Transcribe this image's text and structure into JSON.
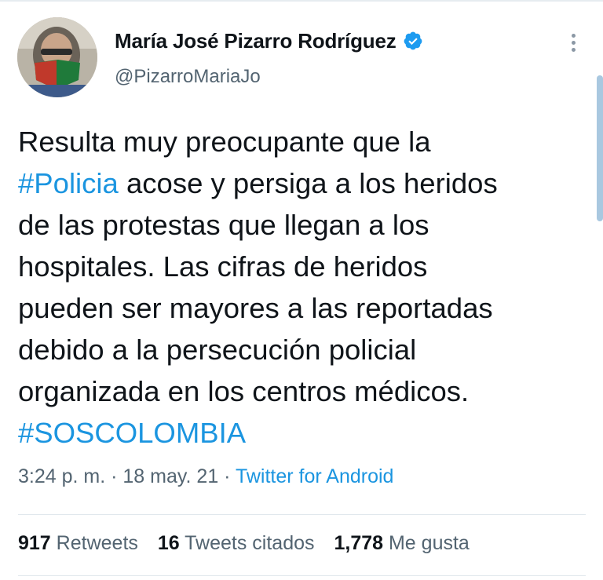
{
  "user": {
    "display_name": "María José Pizarro Rodríguez",
    "handle": "@PizarroMariaJo",
    "verified": true
  },
  "tweet": {
    "lines": [
      {
        "segments": [
          {
            "text": "Resulta muy preocupante que la",
            "type": "text"
          }
        ]
      },
      {
        "segments": [
          {
            "text": "#Policia",
            "type": "hashtag"
          },
          {
            "text": " acose y persiga a los heridos",
            "type": "text"
          }
        ]
      },
      {
        "segments": [
          {
            "text": "de las protestas que llegan a los",
            "type": "text"
          }
        ]
      },
      {
        "segments": [
          {
            "text": "hospitales. Las cifras de heridos",
            "type": "text"
          }
        ]
      },
      {
        "segments": [
          {
            "text": "pueden ser mayores a las reportadas",
            "type": "text"
          }
        ]
      },
      {
        "segments": [
          {
            "text": "debido a la persecución policial",
            "type": "text"
          }
        ]
      },
      {
        "segments": [
          {
            "text": "organizada en los centros médicos.",
            "type": "text"
          }
        ]
      },
      {
        "segments": [
          {
            "text": "#SOSCOLOMBIA",
            "type": "hashtag"
          }
        ]
      }
    ]
  },
  "meta": {
    "time": "3:24 p. m.",
    "separator": " · ",
    "date": "18 may. 21",
    "source": "Twitter for Android"
  },
  "stats": {
    "retweets_count": "917",
    "retweets_label": "Retweets",
    "quotes_count": "16",
    "quotes_label": "Tweets citados",
    "likes_count": "1,778",
    "likes_label": "Me gusta"
  },
  "colors": {
    "link": "#1b95e0",
    "verified_badge": "#1d9bf0",
    "secondary_text": "#536471",
    "primary_text": "#0f1419"
  },
  "icons": [
    "verified-badge-icon",
    "more-options-icon"
  ]
}
